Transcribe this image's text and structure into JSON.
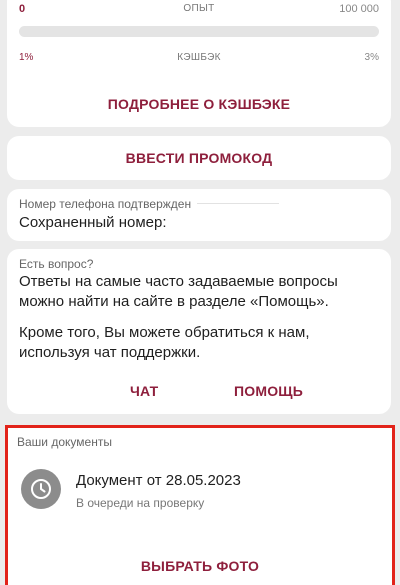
{
  "progress": {
    "experience": {
      "left": "0",
      "label": "ОПЫТ",
      "right": "100 000",
      "fill": 0.0
    },
    "cashback": {
      "left": "1%",
      "label": "КЭШБЭК",
      "right": "3%"
    },
    "more_label": "ПОДРОБНЕЕ О КЭШБЭКЕ"
  },
  "promo": {
    "button_label": "ВВЕСТИ ПРОМОКОД"
  },
  "phone": {
    "caption": "Номер телефона подтвержден",
    "text": "Сохраненный номер:"
  },
  "faq": {
    "caption": "Есть вопрос?",
    "line1": "Ответы на самые часто задаваемые вопросы можно найти на сайте в разделе «Помощь».",
    "line2": "Кроме того, Вы можете обратиться к нам, используя чат поддержки.",
    "chat_label": "ЧАТ",
    "help_label": "ПОМОЩЬ"
  },
  "documents": {
    "caption": "Ваши документы",
    "item": {
      "title": "Документ от 28.05.2023",
      "status": "В очереди на проверку",
      "icon": "clock-icon"
    },
    "choose_photo_label": "ВЫБРАТЬ ФОТО"
  },
  "colors": {
    "accent": "#8e1f3c",
    "highlight": "#e2231a",
    "background": "#ececec"
  }
}
